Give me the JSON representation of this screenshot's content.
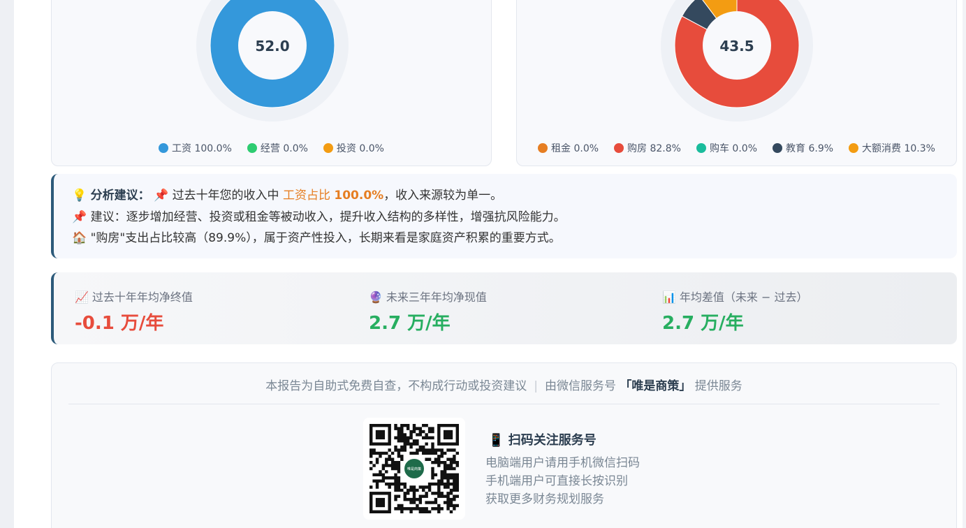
{
  "income_chart": {
    "center_value": "52.0",
    "legend": [
      {
        "label": "工资 100.0%",
        "color": "#3498db"
      },
      {
        "label": "经营 0.0%",
        "color": "#2ecc71"
      },
      {
        "label": "投资 0.0%",
        "color": "#f39c12"
      }
    ],
    "slices": [
      {
        "name": "工资",
        "percent": 100.0,
        "color": "#3498db"
      },
      {
        "name": "经营",
        "percent": 0.0,
        "color": "#2ecc71"
      },
      {
        "name": "投资",
        "percent": 0.0,
        "color": "#f39c12"
      }
    ]
  },
  "expense_chart": {
    "center_value": "43.5",
    "legend": [
      {
        "label": "租金 0.0%",
        "color": "#e67e22"
      },
      {
        "label": "购房 82.8%",
        "color": "#e74c3c"
      },
      {
        "label": "购车 0.0%",
        "color": "#1abc9c"
      },
      {
        "label": "教育 6.9%",
        "color": "#34495e"
      },
      {
        "label": "大额消费 10.3%",
        "color": "#f39c12"
      }
    ],
    "slices": [
      {
        "name": "租金",
        "percent": 0.0,
        "color": "#e67e22"
      },
      {
        "name": "购房",
        "percent": 82.8,
        "color": "#e74c3c"
      },
      {
        "name": "购车",
        "percent": 0.0,
        "color": "#1abc9c"
      },
      {
        "name": "教育",
        "percent": 6.9,
        "color": "#34495e"
      },
      {
        "name": "大额消费",
        "percent": 10.3,
        "color": "#f39c12"
      }
    ]
  },
  "analysis": {
    "icon": "💡",
    "title": "分析建议：",
    "line1_icon": "📌",
    "line1_pre": "过去十年您的收入中",
    "line1_hl_label": "工资占比",
    "line1_hl_value": "100.0%",
    "line1_post": "，收入来源较为单一。",
    "line2_icon": "📌",
    "line2_text": "建议：逐步增加经营、投资或租金等被动收入，提升收入结构的多样性，增强抗风险能力。",
    "line3_icon": "🏠",
    "line3_text": "\"购房\"支出占比较高（89.9%），属于资产性投入，长期来看是家庭资产积累的重要方式。"
  },
  "metrics": [
    {
      "icon": "📈",
      "label": "过去十年年均净终值",
      "value": "-0.1 万/年"
    },
    {
      "icon": "🔮",
      "label": "未来三年年均净现值",
      "value": "2.7 万/年"
    },
    {
      "icon": "📊",
      "label": "年均差值（未来 − 过去）",
      "value": "2.7 万/年"
    }
  ],
  "footer": {
    "disclaimer": "本报告为自助式免费自查，不构成行动或投资建议",
    "separator": "|",
    "service_pre": "由微信服务号",
    "service_name": "「唯是商策」",
    "service_post": "提供服务",
    "scan_icon": "📱",
    "scan_title": "扫码关注服务号",
    "scan_lines": [
      "电脑端用户请用手机微信扫码",
      "手机端用户可直接长按识别",
      "获取更多财务规划服务"
    ],
    "qr_logo_text": "唯是商策"
  }
}
